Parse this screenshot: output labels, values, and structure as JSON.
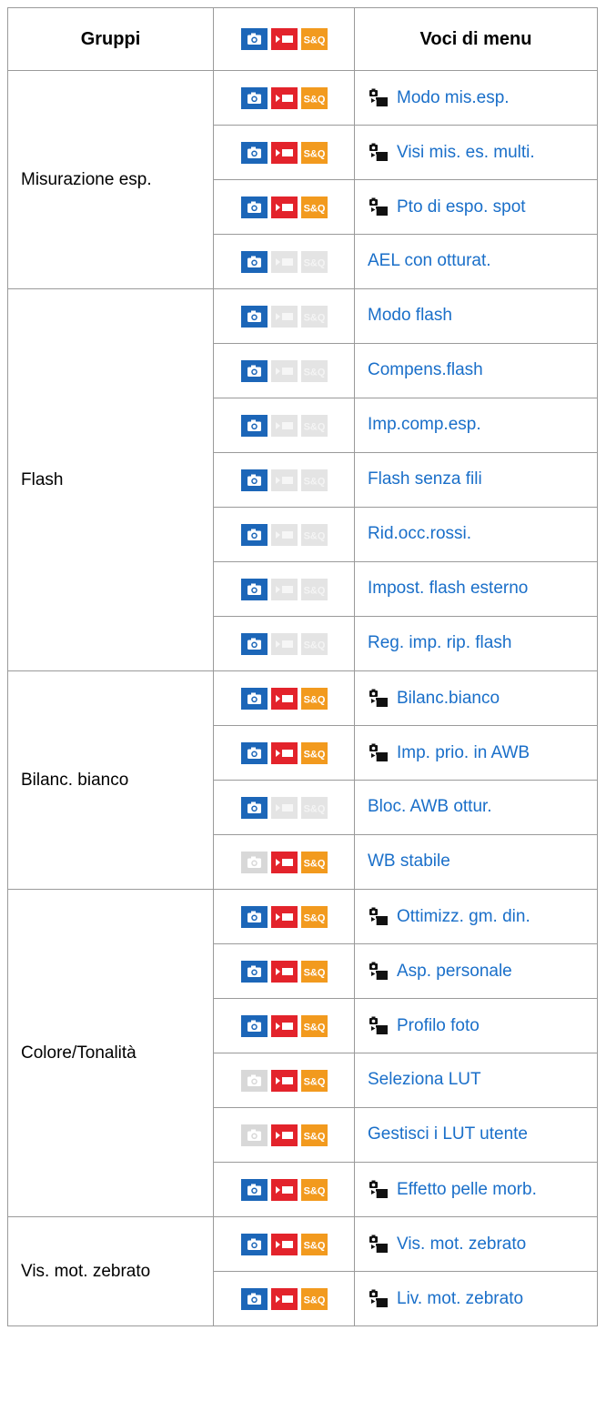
{
  "header": {
    "groups": "Gruppi",
    "items": "Voci di menu"
  },
  "colors": {
    "photo_on": "#1c66b8",
    "movie_on": "#e3232b",
    "sq_on": "#f29a1e",
    "off": "#d8d8d8",
    "link": "#1a6fc9"
  },
  "icons": {
    "photo": "camera-icon",
    "movie": "movie-icon",
    "sq": "s-and-q-icon",
    "per_mode": "per-mode-setting-icon"
  },
  "sq_label": "S&Q",
  "groups": [
    {
      "name": "Misurazione esp.",
      "rows": [
        {
          "photo": true,
          "movie": true,
          "sq": true,
          "per_mode": true,
          "label": "Modo mis.esp."
        },
        {
          "photo": true,
          "movie": true,
          "sq": true,
          "per_mode": true,
          "label": "Visi mis. es. multi."
        },
        {
          "photo": true,
          "movie": true,
          "sq": true,
          "per_mode": true,
          "label": "Pto di espo. spot"
        },
        {
          "photo": true,
          "movie": false,
          "sq": false,
          "per_mode": false,
          "label": "AEL con otturat."
        }
      ]
    },
    {
      "name": "Flash",
      "rows": [
        {
          "photo": true,
          "movie": false,
          "sq": false,
          "per_mode": false,
          "label": "Modo flash"
        },
        {
          "photo": true,
          "movie": false,
          "sq": false,
          "per_mode": false,
          "label": "Compens.flash"
        },
        {
          "photo": true,
          "movie": false,
          "sq": false,
          "per_mode": false,
          "label": "Imp.comp.esp."
        },
        {
          "photo": true,
          "movie": false,
          "sq": false,
          "per_mode": false,
          "label": "Flash senza fili"
        },
        {
          "photo": true,
          "movie": false,
          "sq": false,
          "per_mode": false,
          "label": "Rid.occ.rossi."
        },
        {
          "photo": true,
          "movie": false,
          "sq": false,
          "per_mode": false,
          "label": "Impost. flash esterno"
        },
        {
          "photo": true,
          "movie": false,
          "sq": false,
          "per_mode": false,
          "label": "Reg. imp. rip. flash"
        }
      ]
    },
    {
      "name": "Bilanc. bianco",
      "rows": [
        {
          "photo": true,
          "movie": true,
          "sq": true,
          "per_mode": true,
          "label": "Bilanc.bianco"
        },
        {
          "photo": true,
          "movie": true,
          "sq": true,
          "per_mode": true,
          "label": "Imp. prio. in AWB"
        },
        {
          "photo": true,
          "movie": false,
          "sq": false,
          "per_mode": false,
          "label": "Bloc. AWB ottur."
        },
        {
          "photo": false,
          "movie": true,
          "sq": true,
          "per_mode": false,
          "label": "WB stabile"
        }
      ]
    },
    {
      "name": "Colore/Tonalità",
      "rows": [
        {
          "photo": true,
          "movie": true,
          "sq": true,
          "per_mode": true,
          "label": "Ottimizz. gm. din."
        },
        {
          "photo": true,
          "movie": true,
          "sq": true,
          "per_mode": true,
          "label": "Asp. personale"
        },
        {
          "photo": true,
          "movie": true,
          "sq": true,
          "per_mode": true,
          "label": "Profilo foto"
        },
        {
          "photo": false,
          "movie": true,
          "sq": true,
          "per_mode": false,
          "label": "Seleziona LUT"
        },
        {
          "photo": false,
          "movie": true,
          "sq": true,
          "per_mode": false,
          "label": "Gestisci i LUT utente"
        },
        {
          "photo": true,
          "movie": true,
          "sq": true,
          "per_mode": true,
          "label": "Effetto pelle morb."
        }
      ]
    },
    {
      "name": "Vis. mot. zebrato",
      "rows": [
        {
          "photo": true,
          "movie": true,
          "sq": true,
          "per_mode": true,
          "label": "Vis. mot. zebrato"
        },
        {
          "photo": true,
          "movie": true,
          "sq": true,
          "per_mode": true,
          "label": "Liv. mot. zebrato"
        }
      ]
    }
  ]
}
